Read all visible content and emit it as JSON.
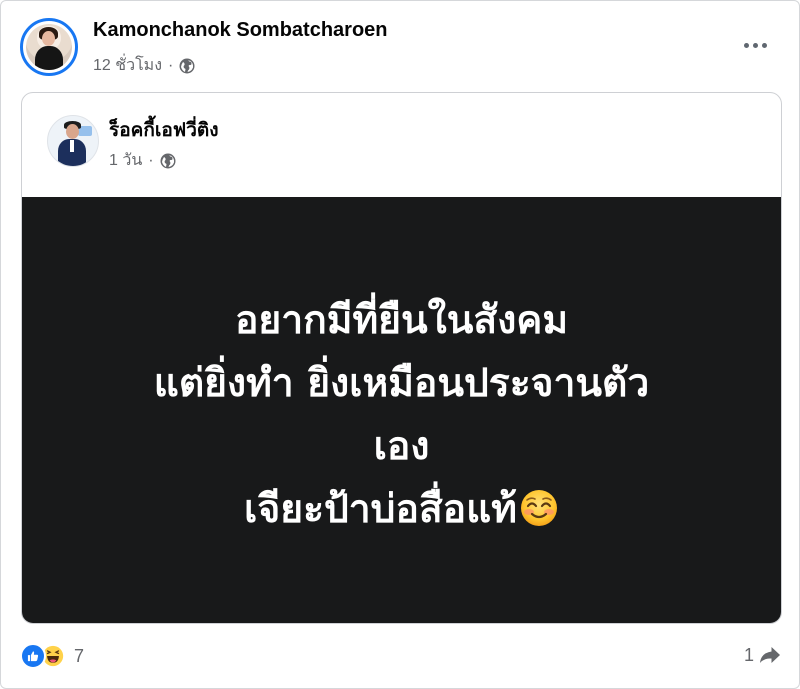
{
  "post": {
    "author": "Kamonchanok Sombatcharoen",
    "time": "12 ชั่วโมง",
    "separator": "·",
    "privacy_icon": "globe-icon",
    "more_icon": "more-options-icon"
  },
  "shared_post": {
    "author": "ร็อคกี้เอฟวี่ติง",
    "time": "1 วัน",
    "separator": "·",
    "privacy_icon": "globe-icon",
    "background_color": "#18191a",
    "text_lines": [
      "อยากมีที่ยืนในสังคม",
      "แต่ยิ่งทำ ยิ่งเหมือนประจานตัว",
      "เอง",
      "เจียะป้าบ่อสื่อแท้"
    ],
    "trailing_emoji": "smiling-face-with-blush-emoji"
  },
  "reactions": {
    "icons": [
      "like-icon",
      "haha-icon"
    ],
    "count": "7"
  },
  "shares": {
    "count": "1",
    "icon": "share-arrow-icon"
  },
  "colors": {
    "brand": "#1877f2",
    "muted_text": "#65676b",
    "panel": "#18191a"
  }
}
